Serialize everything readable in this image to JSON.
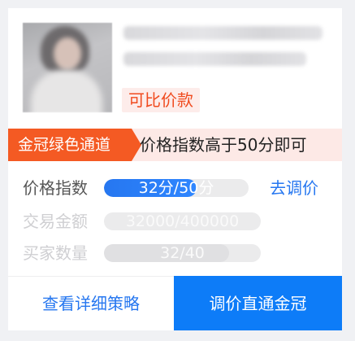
{
  "product": {
    "compare_tag": "可比价款"
  },
  "banner": {
    "tag": "金冠绿色通道",
    "text": "价格指数高于50分即可"
  },
  "metrics": [
    {
      "label": "价格指数",
      "value_text": "32分/50分",
      "progress": 0.64
    },
    {
      "label": "交易金额",
      "value_text": "32000/400000",
      "progress": 0.08
    },
    {
      "label": "买家数量",
      "value_text": "32/40",
      "progress": 0.8
    }
  ],
  "actions": {
    "adjust_link": "去调价",
    "strategy_button": "查看详细策略",
    "primary_button": "调价直通金冠"
  },
  "colors": {
    "accent": "#2677f0",
    "tag_orange": "#f45a23",
    "banner_bg": "#fde9e6",
    "primary_button": "#0d7cf8"
  }
}
